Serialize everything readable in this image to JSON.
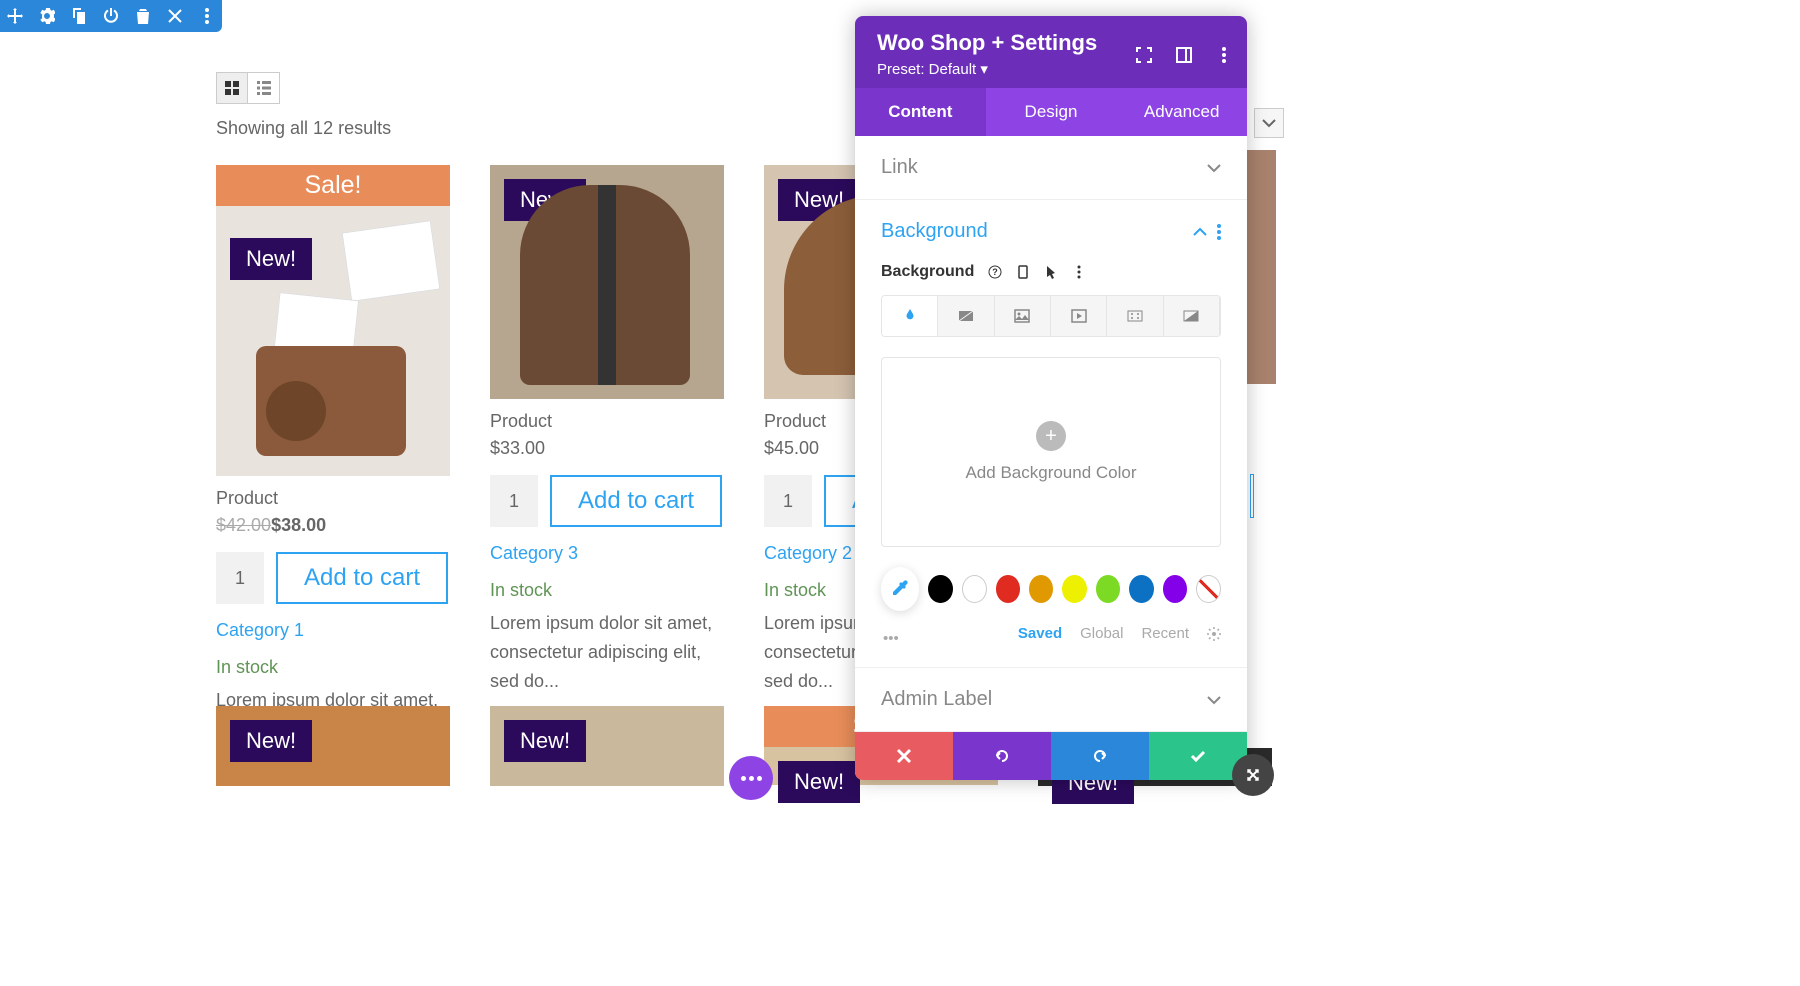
{
  "toolbar_icons": [
    "move",
    "gear",
    "duplicate",
    "power",
    "trash",
    "close",
    "more"
  ],
  "shop": {
    "results_text": "Showing all 12 results",
    "new_label": "New!",
    "sale_label": "Sale!",
    "products_row1": [
      {
        "name": "Product",
        "sale": true,
        "old": "$42.00",
        "price": "$38.00",
        "qty": "1",
        "btn": "Add to cart",
        "cat": "Category 1",
        "stock": "In stock",
        "desc": "Lorem ipsum dolor sit amet, consectetur adipiscing elit, sed do..."
      },
      {
        "name": "Product",
        "price": "$33.00",
        "qty": "1",
        "btn": "Add to cart",
        "cat": "Category 3",
        "stock": "In stock",
        "desc": "Lorem ipsum dolor sit amet, consectetur adipiscing elit, sed do..."
      },
      {
        "name": "Product",
        "price": "$45.00",
        "qty": "1",
        "btn": "A",
        "cat": "Category 2",
        "stock": "In stock",
        "desc": "Lorem ipsum dolor sit amet, consectetur adipiscing elit, sed do..."
      }
    ]
  },
  "panel": {
    "title": "Woo Shop + Settings",
    "preset": "Preset: Default ▾",
    "tabs": [
      "Content",
      "Design",
      "Advanced"
    ],
    "section_link": "Link",
    "section_bg": "Background",
    "section_admin": "Admin Label",
    "bg_label": "Background",
    "add_bg": "Add Background Color",
    "palette": [
      "Saved",
      "Global",
      "Recent"
    ],
    "swatches": [
      "#000000",
      "#ffffff",
      "#e02b20",
      "#e09900",
      "#edf000",
      "#7cda24",
      "#0c71c3",
      "#8300e9"
    ]
  }
}
